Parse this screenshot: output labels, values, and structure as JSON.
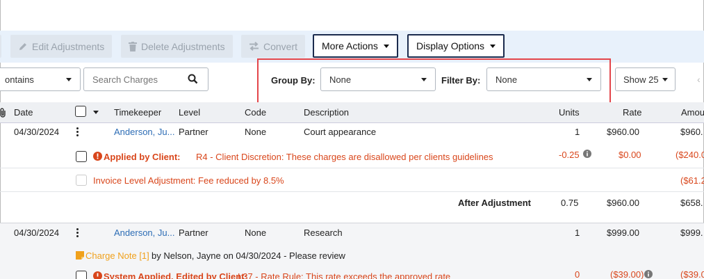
{
  "toolbar": {
    "edit_adjustments": "Edit Adjustments",
    "delete_adjustments": "Delete Adjustments",
    "convert": "Convert",
    "more_actions": "More Actions",
    "display_options": "Display Options"
  },
  "filters": {
    "contains_value": "ontains",
    "search_placeholder": "Search Charges",
    "group_by_label": "Group By:",
    "group_by_value": "None",
    "filter_by_label": "Filter By:",
    "filter_by_value": "None",
    "show_value": "Show 25"
  },
  "columns": {
    "date": "Date",
    "timekeeper": "Timekeeper",
    "level": "Level",
    "code": "Code",
    "description": "Description",
    "units": "Units",
    "rate": "Rate",
    "amount": "Amou"
  },
  "rows": [
    {
      "date": "04/30/2024",
      "timekeeper": "Anderson, Ju...",
      "level": "Partner",
      "code": "None",
      "description": "Court appearance",
      "units": "1",
      "rate": "$960.00",
      "amount": "$960."
    },
    {
      "date": "04/30/2024",
      "timekeeper": "Anderson, Ju...",
      "level": "Partner",
      "code": "None",
      "description": "Research",
      "units": "1",
      "rate": "$999.00",
      "amount": "$999."
    }
  ],
  "adjustment1": {
    "prefix": "Applied by Client:",
    "text": "R4 - Client Discretion: These charges are disallowed per clients guidelines",
    "units": "-0.25",
    "rate": "$0.00",
    "amount": "($240.0"
  },
  "invoice_adjustment": {
    "text": "Invoice Level Adjustment: Fee reduced by 8.5%",
    "amount": "($61.2"
  },
  "after_adjustment": {
    "label": "After Adjustment",
    "units": "0.75",
    "rate": "$960.00",
    "amount": "$658."
  },
  "charge_note": {
    "link": "Charge Note [1]",
    "text": "by Nelson, Jayne on 04/30/2024 - Please review"
  },
  "adjustment2": {
    "prefix": "System Applied, Edited by Client:",
    "text": "L37 - Rate Rule: This rate exceeds the approved rate",
    "units": "0",
    "rate": "($39.00)",
    "amount": "($39.0"
  },
  "colors": {
    "accent_red": "#d9461b",
    "link_blue": "#2d6db5",
    "note_orange": "#f0a11c",
    "highlight": "#e3454a",
    "toolbar_bg": "#e8f1fb"
  }
}
